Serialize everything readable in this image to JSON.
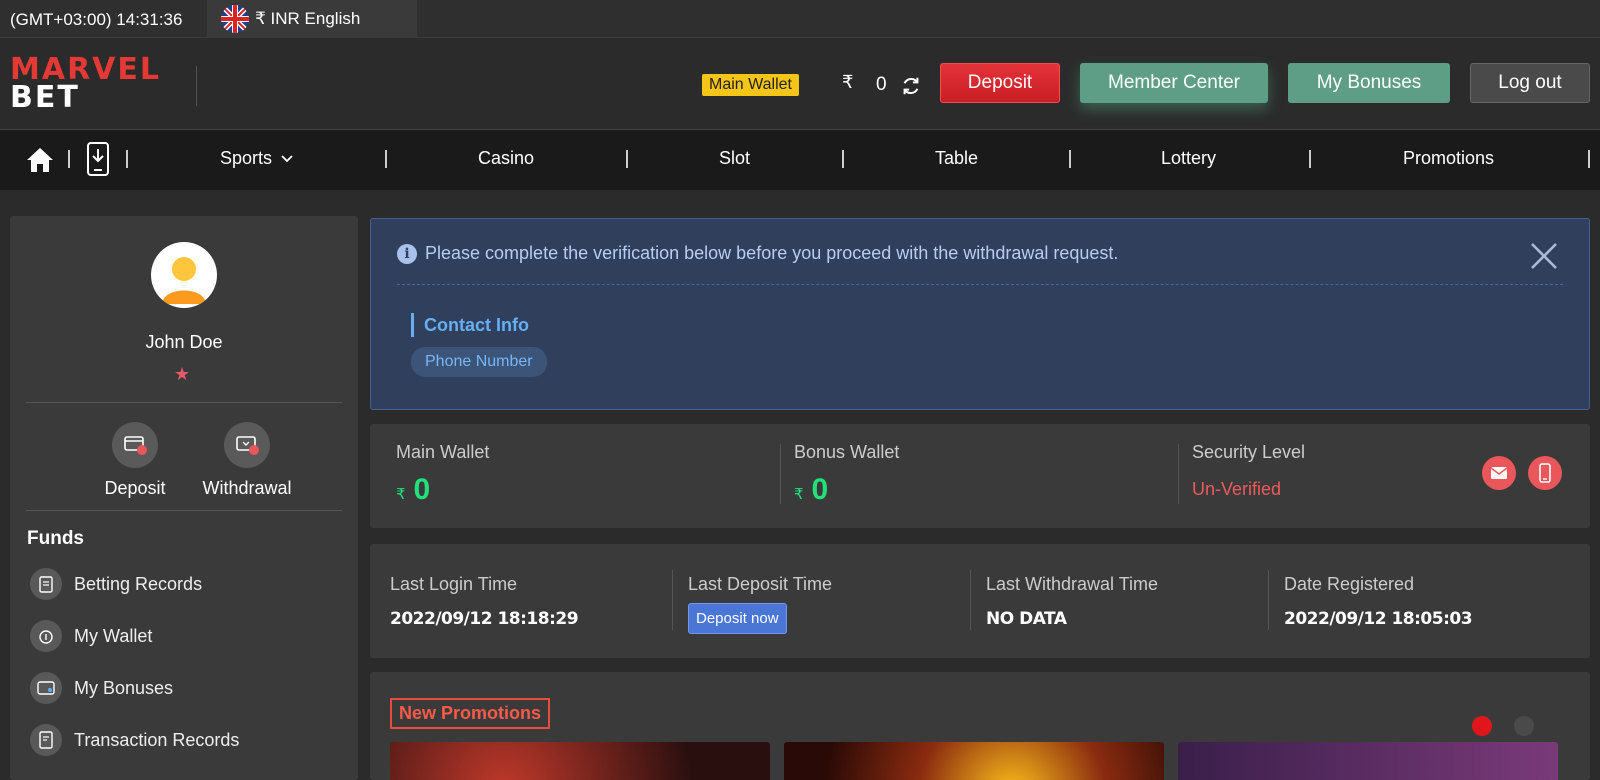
{
  "topbar": {
    "clock": "(GMT+03:00) 14:31:36",
    "currency_lang": "₹ INR English"
  },
  "header": {
    "logo_line1": "MARVEL",
    "logo_line2": "BET",
    "wallet_tag": "Main Wallet",
    "currency_symbol": "₹",
    "balance": "0",
    "buttons": {
      "deposit": "Deposit",
      "member_center": "Member Center",
      "my_bonuses": "My Bonuses",
      "logout": "Log out"
    }
  },
  "nav": {
    "items": [
      "Sports",
      "Casino",
      "Slot",
      "Table",
      "Lottery",
      "Promotions"
    ]
  },
  "sidebar": {
    "username": "John Doe",
    "star": "★",
    "quick_actions": [
      "Deposit",
      "Withdrawal"
    ],
    "funds_title": "Funds",
    "menu": [
      "Betting Records",
      "My Wallet",
      "My Bonuses",
      "Transaction Records"
    ]
  },
  "alert": {
    "message": "Please complete the verification below before you proceed with the withdrawal request.",
    "section_title": "Contact Info",
    "chip": "Phone Number"
  },
  "wallets": {
    "main_label": "Main Wallet",
    "main_symbol": "₹",
    "main_value": "0",
    "bonus_label": "Bonus Wallet",
    "bonus_symbol": "₹",
    "bonus_value": "0",
    "security_label": "Security Level",
    "security_status": "Un-Verified"
  },
  "times": {
    "last_login_label": "Last Login Time",
    "last_login_value": "2022/09/12 18:18:29",
    "last_deposit_label": "Last Deposit Time",
    "last_deposit_button": "Deposit now",
    "last_withdrawal_label": "Last Withdrawal Time",
    "last_withdrawal_value": "NO DATA",
    "registered_label": "Date Registered",
    "registered_value": "2022/09/12 18:05:03"
  },
  "promotions": {
    "title": "New Promotions"
  },
  "colors": {
    "accent_red": "#e6333a",
    "accent_green": "#5f9e86",
    "money_green": "#22e07a",
    "alert_bg": "#2f3f5c",
    "warn_yellow": "#f5c518"
  }
}
